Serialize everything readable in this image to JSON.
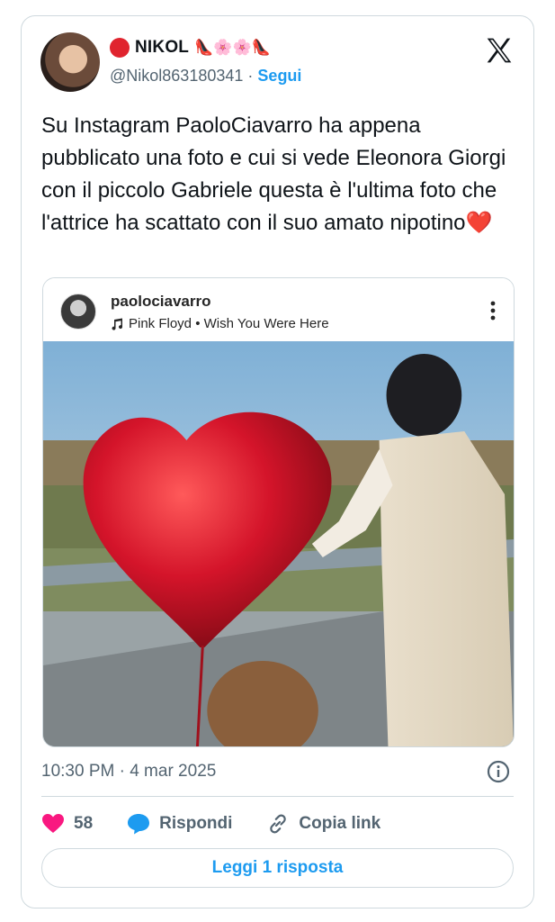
{
  "author": {
    "display_name": "NIKOL",
    "name_emoji": "👠🌸🌸👠",
    "handle": "@Nikol863180341",
    "separator": "·",
    "follow_label": "Segui"
  },
  "tweet": {
    "text": "Su Instagram PaoloCiavarro ha appena pubblicato una foto e cui si vede Eleonora Giorgi con il piccolo Gabriele questa è l'ultima foto che l'attrice ha scattato con il suo amato nipotino",
    "emoji": "❤️",
    "timestamp": "10:30 PM · 4 mar 2025"
  },
  "embed": {
    "username": "paolociavarro",
    "music": "Pink Floyd • Wish You Were Here"
  },
  "actions": {
    "like_count": "58",
    "reply_label": "Rispondi",
    "copy_label": "Copia link"
  },
  "read_replies_label": "Leggi 1 risposta",
  "colors": {
    "accent": "#1d9bf0",
    "like": "#f91880",
    "text": "#0f1419",
    "muted": "#536471",
    "border": "#cfd9de"
  },
  "icons": [
    "x-logo-icon",
    "more-icon",
    "music-note-icon",
    "info-icon",
    "heart-icon",
    "reply-icon",
    "link-icon"
  ]
}
